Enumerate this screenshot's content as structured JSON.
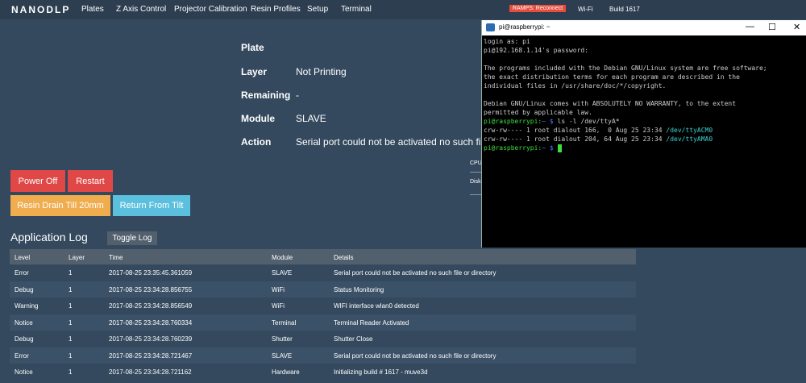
{
  "nav": {
    "logo": "NANODLP",
    "items": [
      "Plates",
      "Z Axis Control",
      "Projector Calibration",
      "Resin Profiles",
      "Setup",
      "Terminal"
    ],
    "ramps_badge": "RAMPS: Reconnect",
    "wifi": "Wi-Fi",
    "build": "Build 1617"
  },
  "status": {
    "plate_label": "Plate",
    "layer_label": "Layer",
    "layer_value": "Not Printing",
    "remaining_label": "Remaining",
    "remaining_value": "-",
    "module_label": "Module",
    "module_value": "SLAVE",
    "action_label": "Action",
    "action_value": "Serial port could not be activated no such file or"
  },
  "partial_labels": {
    "cpu": "CPU",
    "disk": "Disk"
  },
  "buttons": {
    "power_off": "Power Off",
    "restart": "Restart",
    "resin_drain": "Resin Drain Till 20mm",
    "return_tilt": "Return From Tilt"
  },
  "log": {
    "title": "Application Log",
    "toggle": "Toggle Log",
    "columns": [
      "Level",
      "Layer",
      "Time",
      "Module",
      "Details"
    ],
    "rows": [
      [
        "Error",
        "1",
        "2017-08-25 23:35:45.361059",
        "SLAVE",
        "Serial port could not be activated no such file or directory"
      ],
      [
        "Debug",
        "1",
        "2017-08-25 23:34:28.856755",
        "WiFi",
        "Status Monitoring"
      ],
      [
        "Warning",
        "1",
        "2017-08-25 23:34:28.856549",
        "WiFi",
        "WIFI interface wlan0 detected"
      ],
      [
        "Notice",
        "1",
        "2017-08-25 23:34:28.760334",
        "Terminal",
        "Terminal Reader Activated"
      ],
      [
        "Debug",
        "1",
        "2017-08-25 23:34:28.760239",
        "Shutter",
        "Shutter Close"
      ],
      [
        "Error",
        "1",
        "2017-08-25 23:34:28.721467",
        "SLAVE",
        "Serial port could not be activated no such file or directory"
      ],
      [
        "Notice",
        "1",
        "2017-08-25 23:34:28.721162",
        "Hardware",
        "Initializing build # 1617 - muve3d"
      ]
    ]
  },
  "terminal": {
    "title": "pi@raspberrypi: ~",
    "minimize": "—",
    "maximize": "☐",
    "close": "✕",
    "line1": "login as: pi",
    "line2": "pi@192.168.1.14's password:",
    "line3": "The programs included with the Debian GNU/Linux system are free software;",
    "line4": "the exact distribution terms for each program are described in the",
    "line5": "individual files in /usr/share/doc/*/copyright.",
    "line6": "Debian GNU/Linux comes with ABSOLUTELY NO WARRANTY, to the extent",
    "line7": "permitted by applicable law.",
    "prompt_user": "pi@raspberrypi:",
    "prompt_path": "~ $",
    "cmd": " ls -l /dev/ttyA*",
    "out1_prefix": "crw-rw---- 1 root dialout 166,  0 Aug 25 23:34 ",
    "out1_dev": "/dev/ttyACM0",
    "out2_prefix": "crw-rw---- 1 root dialout 204, 64 Aug 25 23:34 ",
    "out2_dev": "/dev/ttyAMA0"
  },
  "colors": {
    "background": "#34495e",
    "navbar": "#2c3e50",
    "danger": "#e04848",
    "warning": "#f0ad4e",
    "info": "#5bc0de",
    "terminal_green": "#3fdc3f"
  }
}
